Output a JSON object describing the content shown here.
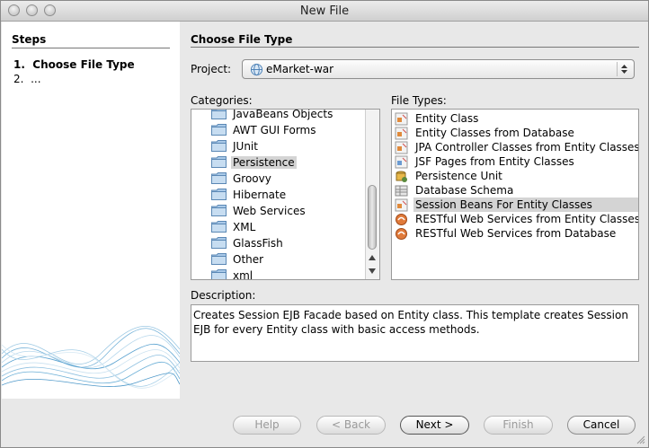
{
  "window": {
    "title": "New File"
  },
  "steps": {
    "heading": "Steps",
    "items": [
      {
        "num": "1.",
        "label": "Choose File Type"
      },
      {
        "num": "2.",
        "label": "..."
      }
    ]
  },
  "main": {
    "section_title": "Choose File Type",
    "project_label": "Project:",
    "project_value": "eMarket-war",
    "categories_label": "Categories:",
    "categories": [
      "JavaBeans Objects",
      "AWT GUI Forms",
      "JUnit",
      "Persistence",
      "Groovy",
      "Hibernate",
      "Web Services",
      "XML",
      "GlassFish",
      "Other",
      "xml"
    ],
    "selected_category": "Persistence",
    "file_types_label": "File Types:",
    "file_types": [
      {
        "label": "Entity Class",
        "icon": "entity-class-icon"
      },
      {
        "label": "Entity Classes from Database",
        "icon": "entity-db-icon"
      },
      {
        "label": "JPA Controller Classes from Entity Classes",
        "icon": "jpa-controller-icon"
      },
      {
        "label": "JSF Pages from Entity Classes",
        "icon": "jsf-pages-icon"
      },
      {
        "label": "Persistence Unit",
        "icon": "persistence-unit-icon"
      },
      {
        "label": "Database Schema",
        "icon": "database-schema-icon"
      },
      {
        "label": "Session Beans For Entity Classes",
        "icon": "session-bean-icon"
      },
      {
        "label": "RESTful Web Services from Entity Classes",
        "icon": "rest-service-icon"
      },
      {
        "label": "RESTful Web Services from Database",
        "icon": "rest-db-icon"
      }
    ],
    "selected_file_type": "Session Beans For Entity Classes",
    "description_label": "Description:",
    "description": "Creates Session EJB Facade based on Entity class. This template creates Session EJB for every Entity class with basic access methods."
  },
  "buttons": {
    "help": "Help",
    "back": "< Back",
    "next": "Next >",
    "finish": "Finish",
    "cancel": "Cancel"
  },
  "colors": {
    "selection": "#d4d4d4",
    "window_bg": "#e8e8e8"
  }
}
